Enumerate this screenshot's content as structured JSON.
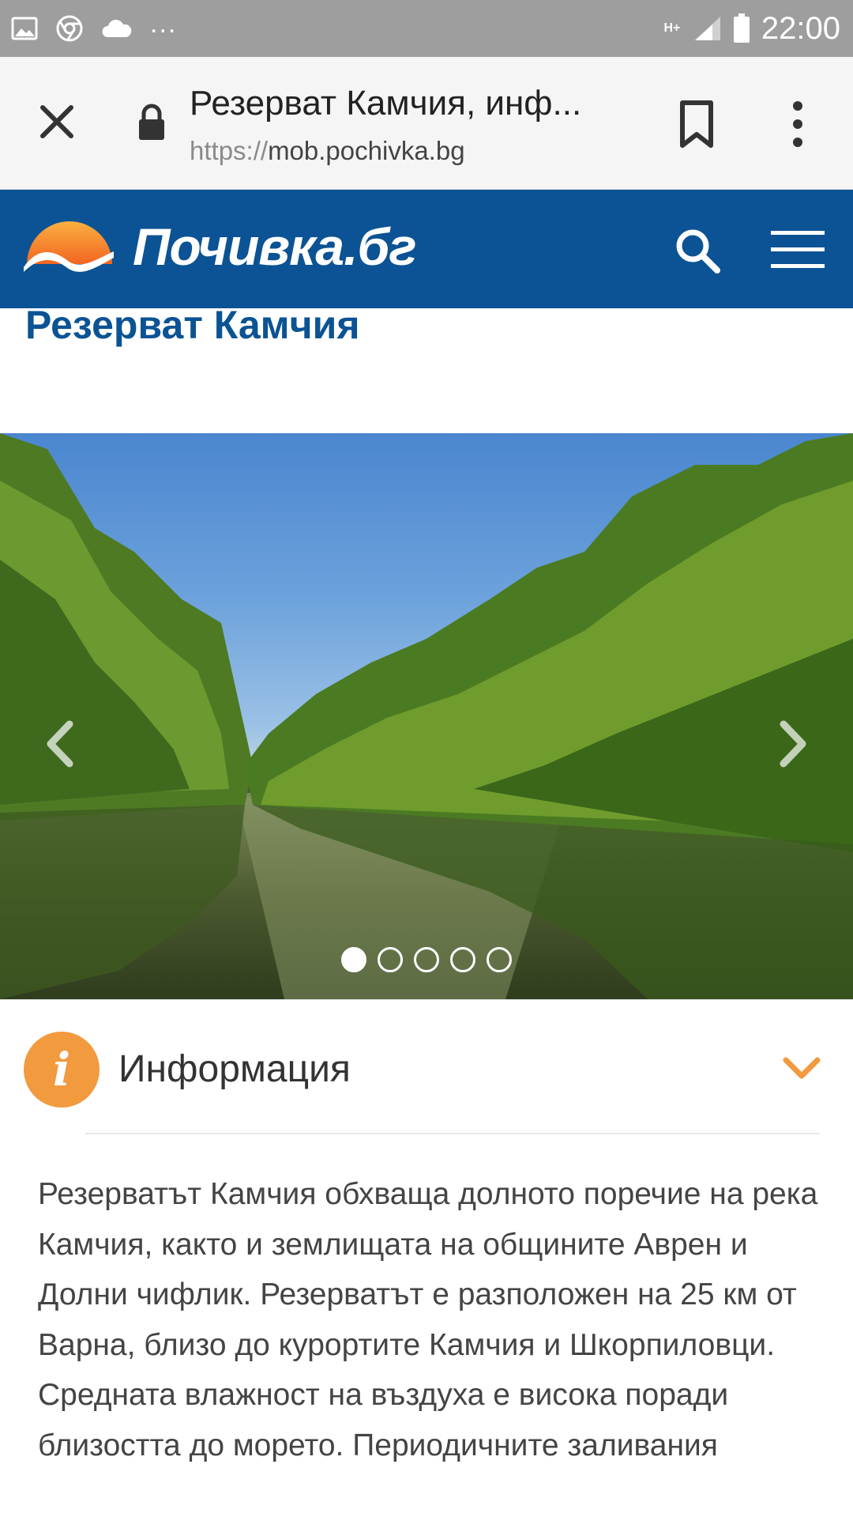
{
  "status_bar": {
    "time": "22:00",
    "network": "H+",
    "overflow": "...",
    "icons": [
      "gallery-icon",
      "chrome-icon",
      "cloud-icon",
      "signal-icon",
      "battery-icon"
    ]
  },
  "browser": {
    "page_title": "Резерват Камчия, инф...",
    "url_scheme": "https://",
    "url_host": "mob.pochivka.bg"
  },
  "site": {
    "logo_text": "Почивка.бг",
    "brand_color": "#0b5394",
    "accent_color": "#f29a3e"
  },
  "page": {
    "title": "Резерват Камчия"
  },
  "gallery": {
    "slide_count": 5,
    "active_slide": 1
  },
  "info": {
    "icon_letter": "i",
    "heading": "Информация",
    "text": "Резерватът Камчия обхваща долното поречие на река Камчия, както и землищата на общините Аврен и Долни чифлик. Резерватът е разположен на 25 км от Варна, близо до курортите Камчия и Шкорпиловци. Средната влажност на въздуха е висока поради близостта до морето. Периодичните заливания"
  }
}
